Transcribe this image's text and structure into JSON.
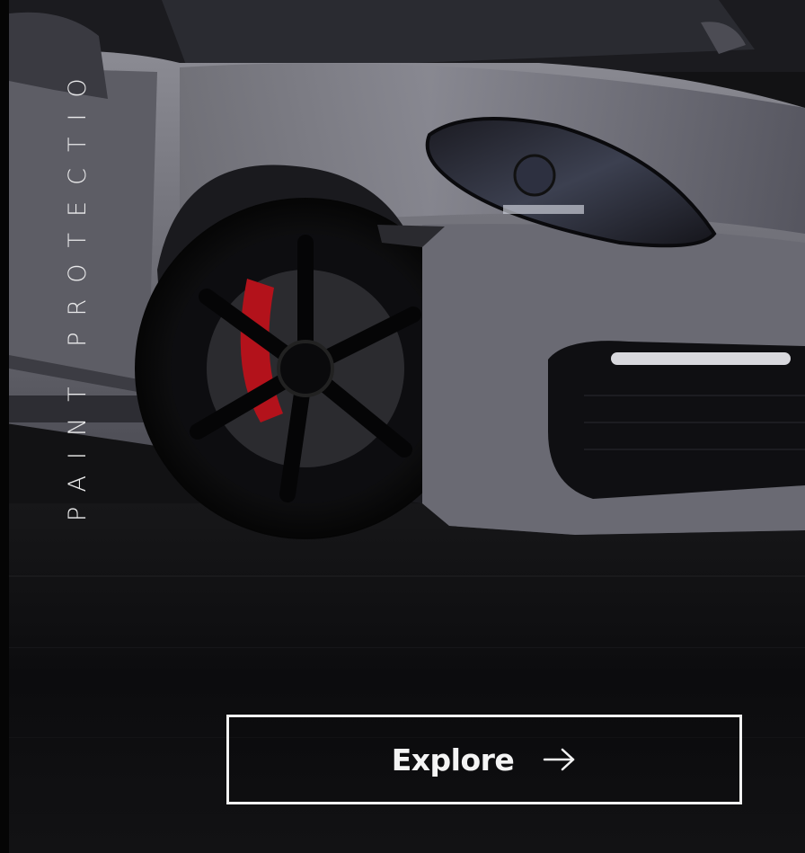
{
  "hero": {
    "vertical_title": "PAINT PROTECTIO",
    "cta": {
      "label": "Explore",
      "icon": "arrow-right-icon"
    }
  },
  "colors": {
    "background": "#121214",
    "car_body": "#6f6f78",
    "brake_caliper": "#b3121b",
    "text": "#f1f1f1"
  }
}
